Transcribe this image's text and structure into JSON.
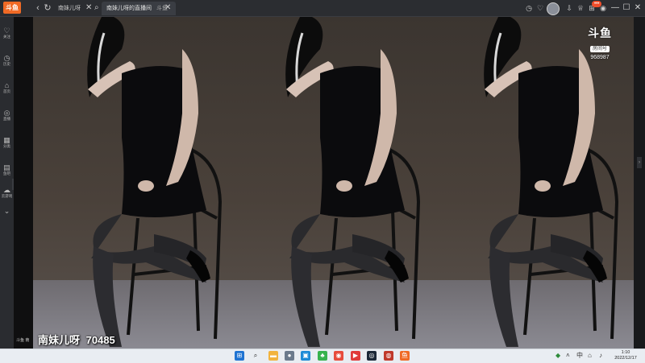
{
  "browser": {
    "logo_text": "斗鱼",
    "tabs": [
      {
        "label": "南妹儿呀"
      },
      {
        "label": "南妹儿呀的直播间",
        "suffix": "斗鱼"
      }
    ]
  },
  "sidebar": {
    "items": [
      {
        "label": "关注",
        "icon": "heart-icon"
      },
      {
        "label": "历史",
        "icon": "clock-icon"
      },
      {
        "label": "首页",
        "icon": "home-icon"
      },
      {
        "label": "直播",
        "icon": "live-icon"
      },
      {
        "label": "分类",
        "icon": "category-icon"
      },
      {
        "label": "鱼吧",
        "icon": "fish-bar-icon"
      },
      {
        "label": "云游戏",
        "icon": "cloud-game-icon"
      }
    ]
  },
  "player": {
    "streamer_name": "南妹儿呀",
    "room_id": "70485",
    "watermark_logo": "斗鱼",
    "watermark_sub": "房间号",
    "watermark_room": "968987"
  },
  "status": {
    "footer_text": "斗鱼 南"
  },
  "taskbar": {
    "time": "1:10",
    "date": "2022/12/17"
  },
  "colors": {
    "brand": "#f06a25",
    "background": "#1f2124",
    "taskbar": "#e9edf2"
  }
}
